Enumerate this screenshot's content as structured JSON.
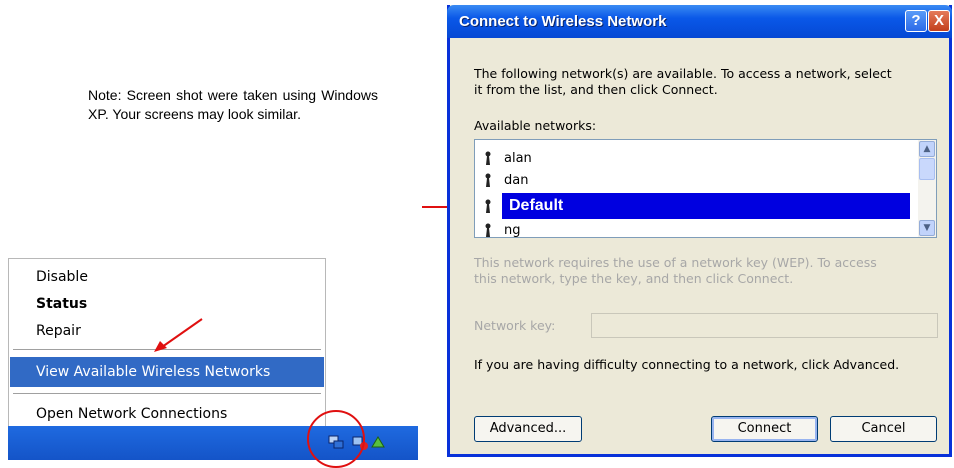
{
  "note": "Note: Screen shot were taken using Windows XP.  Your screens may look similar.",
  "context_menu": {
    "items": [
      {
        "label": "Disable"
      },
      {
        "label": "Status"
      },
      {
        "label": "Repair"
      },
      {
        "label": "View Available Wireless Networks"
      },
      {
        "label": "Open Network Connections"
      }
    ]
  },
  "dialog": {
    "title": "Connect to Wireless Network",
    "help_button": "?",
    "close_button": "X",
    "intro_line1": "The following network(s) are available. To access a network, select",
    "intro_line2": "it from the list, and then click Connect.",
    "available_label": "Available networks:",
    "networks": [
      {
        "name": "alan"
      },
      {
        "name": "dan"
      },
      {
        "name": "Default",
        "selected": true
      },
      {
        "name": "ng"
      }
    ],
    "wep_line1": "This network requires the use of a network key (WEP). To access",
    "wep_line2": "this network, type the key, and then click Connect.",
    "key_label": "Network key:",
    "key_value": "",
    "advanced_hint": "If you are having difficulty connecting to a network, click Advanced.",
    "buttons": {
      "advanced": "Advanced...",
      "connect": "Connect",
      "cancel": "Cancel"
    }
  },
  "colors": {
    "highlight": "#316ac5",
    "selected_network": "#0000e0",
    "title_bar": "#0548d4",
    "annotation_red": "#e01010"
  }
}
